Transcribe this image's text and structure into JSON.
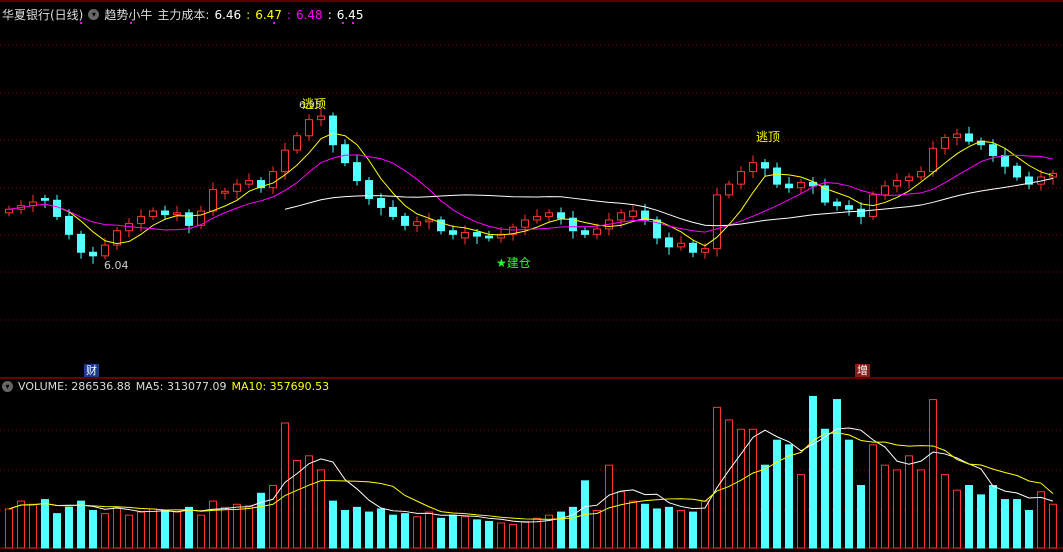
{
  "header": {
    "title": "华夏银行(日线)",
    "indicator_name": "趋势小牛",
    "cost_label": "主力成本:",
    "cost_values": [
      "6.46",
      "6.47",
      "6.48",
      "6.45"
    ],
    "colors": [
      "#ffffff",
      "#ffff00",
      "#ff00ff",
      "#ffffff"
    ]
  },
  "volume_header": {
    "volume": "VOLUME: 286536.88",
    "ma5": "MA5: 313077.09",
    "ma10": "MA10: 357690.53"
  },
  "annotations": {
    "top1": "逃顶",
    "top2": "逃顶",
    "build": "★建仓",
    "low_price": "6.04",
    "high_price": "6.95",
    "fin_marker": "财",
    "add_marker": "增"
  },
  "colors": {
    "up": "#ff3333",
    "down": "#54ffff",
    "ma_short": "#ffff00",
    "ma_mid": "#ff00ff",
    "ma_long": "#ffffff",
    "grid": "#8b0000"
  },
  "chart_data": {
    "type": "candlestick",
    "title": "华夏银行(日线)",
    "close": [
      6.34,
      6.36,
      6.38,
      6.39,
      6.3,
      6.2,
      6.1,
      6.08,
      6.14,
      6.22,
      6.26,
      6.3,
      6.33,
      6.31,
      6.32,
      6.25,
      6.33,
      6.45,
      6.44,
      6.48,
      6.5,
      6.46,
      6.55,
      6.67,
      6.75,
      6.84,
      6.86,
      6.7,
      6.6,
      6.5,
      6.4,
      6.35,
      6.3,
      6.25,
      6.27,
      6.28,
      6.22,
      6.2,
      6.21,
      6.19,
      6.18,
      6.2,
      6.24,
      6.28,
      6.3,
      6.32,
      6.29,
      6.22,
      6.2,
      6.23,
      6.28,
      6.32,
      6.33,
      6.28,
      6.18,
      6.13,
      6.15,
      6.1,
      6.12,
      6.42,
      6.48,
      6.55,
      6.6,
      6.57,
      6.48,
      6.46,
      6.49,
      6.47,
      6.38,
      6.36,
      6.34,
      6.3,
      6.42,
      6.47,
      6.5,
      6.52,
      6.55,
      6.68,
      6.74,
      6.76,
      6.72,
      6.7,
      6.64,
      6.58,
      6.52,
      6.48,
      6.52,
      6.54
    ],
    "volume": [
      250000,
      300000,
      280000,
      310000,
      220000,
      260000,
      300000,
      240000,
      220000,
      260000,
      210000,
      230000,
      250000,
      240000,
      230000,
      260000,
      210000,
      300000,
      260000,
      280000,
      270000,
      350000,
      400000,
      800000,
      560000,
      590000,
      500000,
      300000,
      240000,
      260000,
      230000,
      250000,
      210000,
      220000,
      200000,
      230000,
      190000,
      210000,
      200000,
      180000,
      170000,
      160000,
      150000,
      170000,
      190000,
      210000,
      230000,
      260000,
      430000,
      240000,
      530000,
      360000,
      300000,
      280000,
      250000,
      260000,
      240000,
      230000,
      300000,
      900000,
      820000,
      760000,
      760000,
      530000,
      690000,
      660000,
      470000,
      970000,
      760000,
      950000,
      690000,
      400000,
      660000,
      530000,
      500000,
      590000,
      500000,
      950000,
      470000,
      370000,
      400000,
      340000,
      400000,
      310000,
      310000,
      240000,
      360000,
      280000
    ],
    "price_range": [
      5.7,
      7.2
    ],
    "volume_range": [
      0,
      1000000
    ],
    "ma_periods": [
      5,
      10,
      30
    ]
  }
}
